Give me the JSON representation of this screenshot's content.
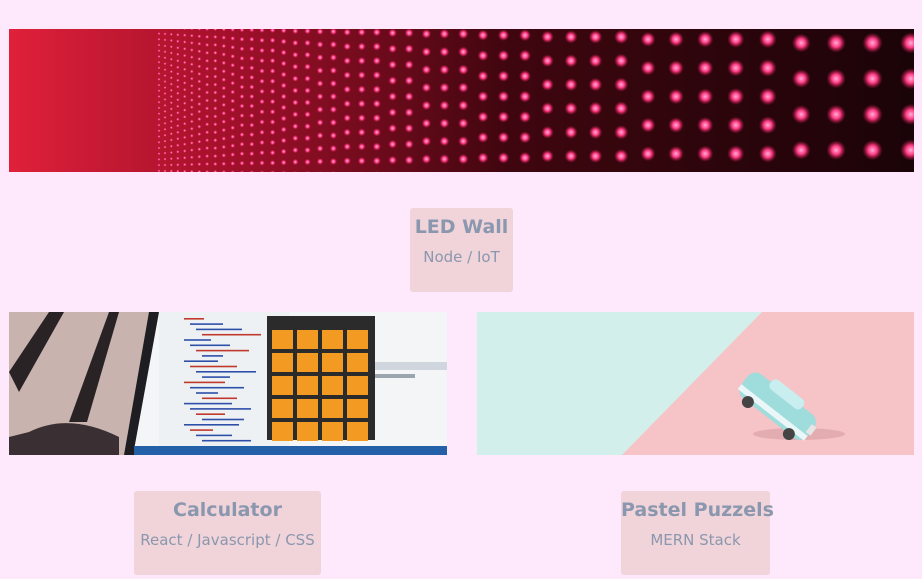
{
  "projects": [
    {
      "title": "LED Wall",
      "tech": "Node / IoT"
    },
    {
      "title": "Calculator",
      "tech": "React / Javascript / CSS"
    },
    {
      "title": "Pastel Puzzels",
      "tech": "MERN Stack"
    }
  ],
  "colors": {
    "page_background": "#fde9fb",
    "caption_background": "#f0d4d9",
    "caption_text": "#8a97ae"
  }
}
